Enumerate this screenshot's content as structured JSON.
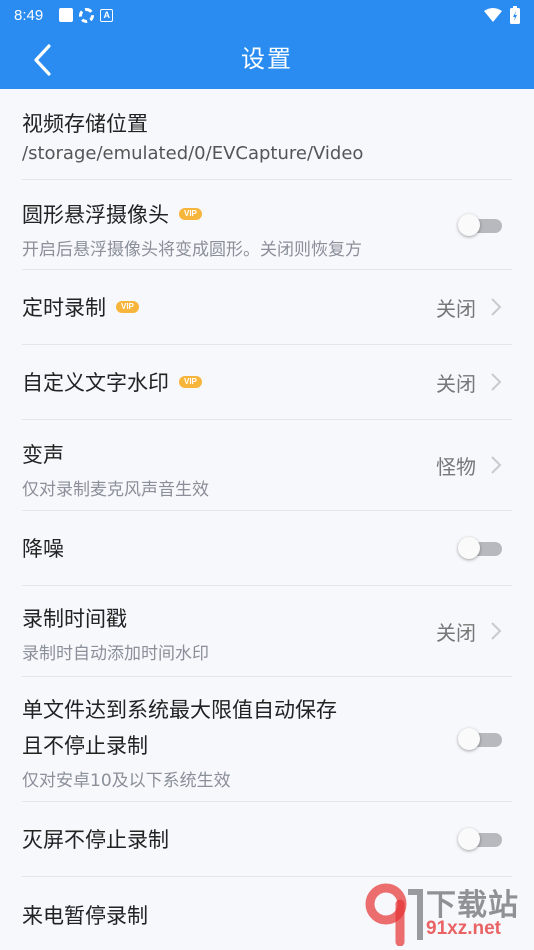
{
  "status_bar": {
    "time": "8:49"
  },
  "header": {
    "title": "设置"
  },
  "settings": {
    "storage": {
      "title": "视频存储位置",
      "subtitle": "/storage/emulated/0/EVCapture/Video"
    },
    "floating_camera": {
      "title": "圆形悬浮摄像头",
      "badge": "VIP",
      "subtitle": "开启后悬浮摄像头将变成圆形。关闭则恢复方",
      "enabled": false
    },
    "timed_recording": {
      "title": "定时录制",
      "badge": "VIP",
      "value": "关闭"
    },
    "text_watermark": {
      "title": "自定义文字水印",
      "badge": "VIP",
      "value": "关闭"
    },
    "voice_change": {
      "title": "变声",
      "subtitle": "仅对录制麦克风声音生效",
      "value": "怪物"
    },
    "noise_reduction": {
      "title": "降噪",
      "enabled": false
    },
    "timestamp": {
      "title": "录制时间戳",
      "subtitle": "录制时自动添加时间水印",
      "value": "关闭"
    },
    "auto_save": {
      "title_line1": "单文件达到系统最大限值自动保存",
      "title_line2": "且不停止录制",
      "subtitle": "仅对安卓10及以下系统生效",
      "enabled": false
    },
    "screen_off": {
      "title": "灭屏不停止录制",
      "enabled": false
    },
    "incoming_call": {
      "title": "来电暂停录制"
    }
  },
  "watermark": {
    "text": "下载站",
    "url": "91xz.net"
  },
  "colors": {
    "primary": "#2a8cf0",
    "vip_badge": "#f7b53b",
    "background": "#f7f8fc"
  }
}
